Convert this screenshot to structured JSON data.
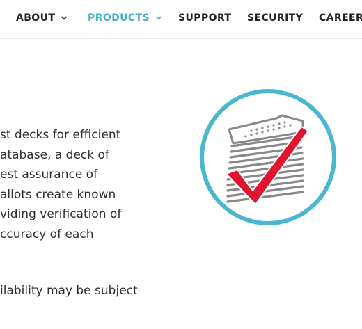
{
  "nav": {
    "items": [
      {
        "label": "ABOUT",
        "has_dropdown": true,
        "active": false
      },
      {
        "label": "PRODUCTS",
        "has_dropdown": true,
        "active": true
      },
      {
        "label": "SUPPORT",
        "has_dropdown": false,
        "active": false
      },
      {
        "label": "SECURITY",
        "has_dropdown": false,
        "active": false
      },
      {
        "label": "CAREERS",
        "has_dropdown": false,
        "active": false
      }
    ],
    "active_color": "#3fb2c8",
    "text_color": "#222222"
  },
  "content": {
    "paragraph_lines": [
      "st decks for efficient",
      "atabase, a deck of",
      "est assurance of",
      "allots create known",
      "viding verification of",
      "ccuracy of each"
    ],
    "second_paragraph": "ilability may be subject"
  },
  "illustration": {
    "icon": "ballot-stack-checkmark-icon",
    "circle_color": "#4ab6cf",
    "check_color": "#e0142f",
    "paper_color": "#888888"
  }
}
